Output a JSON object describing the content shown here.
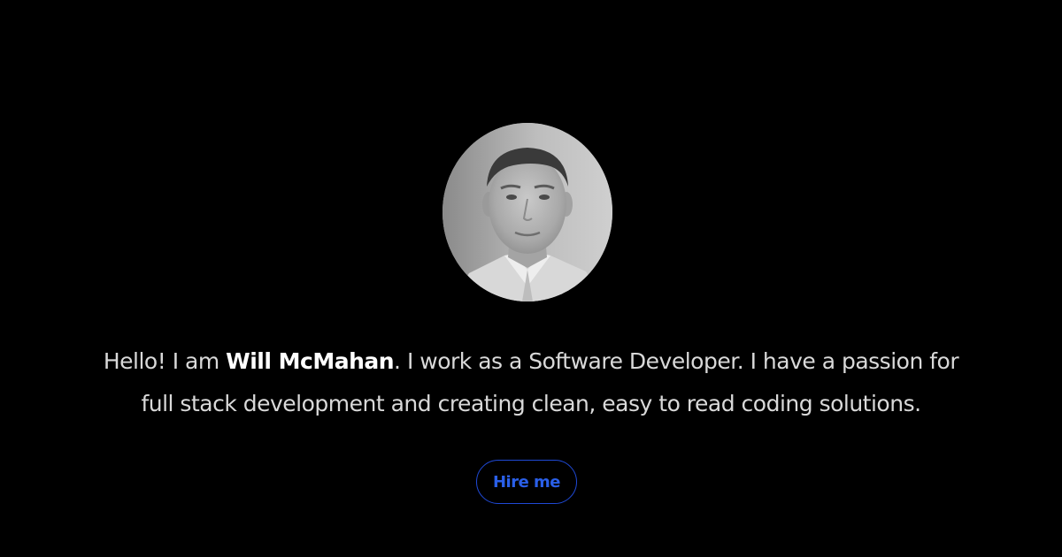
{
  "profile": {
    "avatar_icon": "profile-photo",
    "intro_prefix": "Hello! I am ",
    "name": "Will McMahan",
    "intro_line1_rest": ". I work as a Software Developer. I have a passion for",
    "intro_line2": "full stack development and creating clean, easy to read coding solutions."
  },
  "cta": {
    "hire_label": "Hire me"
  },
  "colors": {
    "background": "#000000",
    "text": "#d9d9d9",
    "name": "#ffffff",
    "accent": "#1f49d6"
  }
}
